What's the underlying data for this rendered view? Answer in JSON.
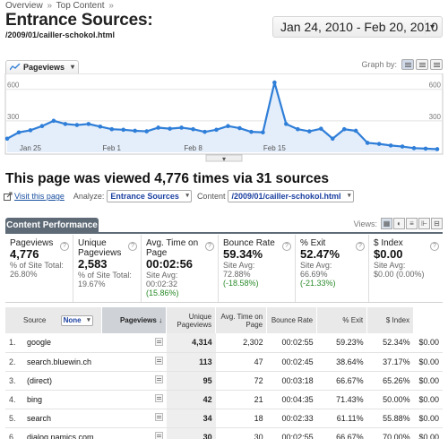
{
  "breadcrumb": {
    "overview": "Overview",
    "sep": "»",
    "top_content": "Top Content",
    "sep2": "»"
  },
  "page_title": "Entrance Sources:",
  "page_path": "/2009/01/cailler-schokol.html",
  "date_range": {
    "label": "Jan 24, 2010 - Feb 20, 2010",
    "caret": "▾"
  },
  "graph": {
    "metric_label": "Pageviews",
    "caret": "▾",
    "graph_by_label": "Graph by:",
    "collapse_icon": "▾"
  },
  "chart_data": {
    "type": "area",
    "series": [
      {
        "name": "Pageviews",
        "values": [
          130,
          190,
          210,
          250,
          300,
          270,
          260,
          270,
          245,
          220,
          215,
          205,
          200,
          235,
          225,
          235,
          220,
          195,
          215,
          250,
          230,
          195,
          190,
          665,
          270,
          220,
          200,
          225,
          130,
          220,
          205,
          90,
          80,
          65,
          55,
          40,
          35,
          30
        ]
      }
    ],
    "x_tick_labels": [
      "Jan 25",
      "Feb 1",
      "Feb 8",
      "Feb 15"
    ],
    "y_tick_labels": [
      "600",
      "300",
      "600",
      "300"
    ],
    "ylim": [
      0,
      700
    ],
    "color": "#2f7ed8",
    "fill_color": "#e4eefa"
  },
  "headline": "This page was viewed 4,776 times via 31 sources",
  "toolbar": {
    "visit_label": "Visit this page",
    "analyze_label": "Analyze:",
    "analyze_value": "Entrance Sources",
    "content_label": "Content",
    "content_value": "/2009/01/cailler-schokol.html",
    "arrow": "▾"
  },
  "content_tab": "Content Performance",
  "views_label": "Views:",
  "view_icons": [
    "▦",
    "◐",
    "≡",
    "⊩",
    "⊟"
  ],
  "help_glyph": "?",
  "metrics": [
    {
      "title": "Pageviews",
      "value": "4,776",
      "sub1": "% of Site Total:",
      "sub2": "26.80%"
    },
    {
      "title": "Unique Pageviews",
      "value": "2,583",
      "sub1": "% of Site Total:",
      "sub2": "19.67%"
    },
    {
      "title": "Avg. Time on Page",
      "value": "00:02:56",
      "sub1": "Site Avg:",
      "sub2": "00:02:32",
      "sub3": "(15.86%)"
    },
    {
      "title": "Bounce Rate",
      "value": "59.34%",
      "sub1": "Site Avg:",
      "sub2": "72.88%",
      "sub3": "(-18.58%)"
    },
    {
      "title": "% Exit",
      "value": "52.47%",
      "sub1": "Site Avg:",
      "sub2": "66.69%",
      "sub3": "(-21.33%)"
    },
    {
      "title": "$ Index",
      "value": "$0.00",
      "sub1": "Site Avg:",
      "sub2": "$0.00 (0.00%)"
    }
  ],
  "table": {
    "headers": {
      "source": "Source",
      "secondary": "None",
      "pageviews": "Pageviews",
      "sort_arrow": "↓",
      "unique": "Unique Pageviews",
      "avg_time": "Avg. Time on Page",
      "bounce": "Bounce Rate",
      "exit": "% Exit",
      "index": "$ Index"
    },
    "rows": [
      {
        "n": "1.",
        "source": "google",
        "pv": "4,314",
        "upv": "2,302",
        "time": "00:02:55",
        "bounce": "59.23%",
        "exit": "52.34%",
        "index": "$0.00"
      },
      {
        "n": "2.",
        "source": "search.bluewin.ch",
        "pv": "113",
        "upv": "47",
        "time": "00:02:45",
        "bounce": "38.64%",
        "exit": "37.17%",
        "index": "$0.00"
      },
      {
        "n": "3.",
        "source": "(direct)",
        "pv": "95",
        "upv": "72",
        "time": "00:03:18",
        "bounce": "66.67%",
        "exit": "65.26%",
        "index": "$0.00"
      },
      {
        "n": "4.",
        "source": "bing",
        "pv": "42",
        "upv": "21",
        "time": "00:04:35",
        "bounce": "71.43%",
        "exit": "50.00%",
        "index": "$0.00"
      },
      {
        "n": "5.",
        "source": "search",
        "pv": "34",
        "upv": "18",
        "time": "00:02:33",
        "bounce": "61.11%",
        "exit": "55.88%",
        "index": "$0.00"
      },
      {
        "n": "6.",
        "source": "dialog.namics.com",
        "pv": "30",
        "upv": "30",
        "time": "00:02:55",
        "bounce": "66.67%",
        "exit": "70.00%",
        "index": "$0.00"
      }
    ]
  }
}
